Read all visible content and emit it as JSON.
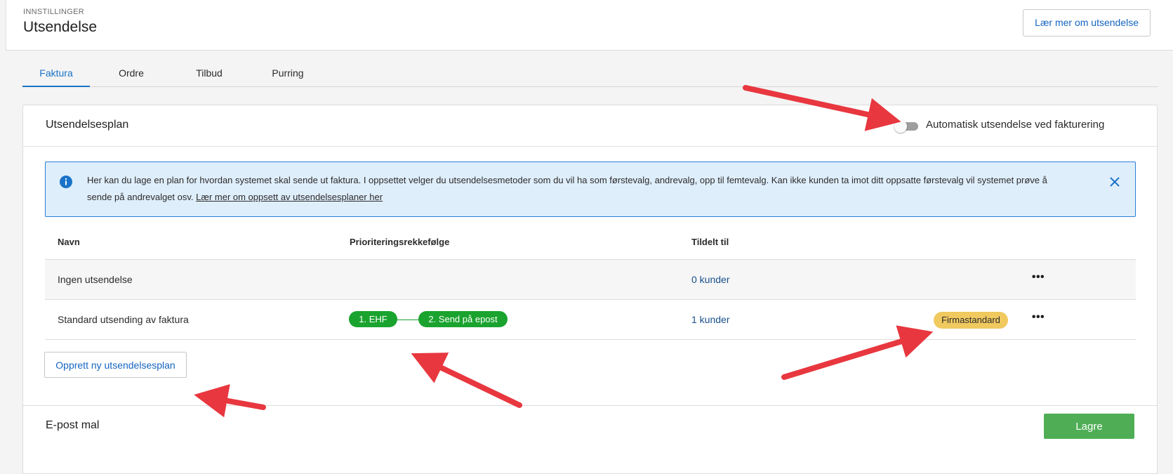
{
  "header": {
    "eyebrow": "INNSTILLINGER",
    "title": "Utsendelse",
    "learn_button": "Lær mer om utsendelse"
  },
  "tabs": [
    {
      "label": "Faktura",
      "active": true
    },
    {
      "label": "Ordre",
      "active": false
    },
    {
      "label": "Tilbud",
      "active": false
    },
    {
      "label": "Purring",
      "active": false
    }
  ],
  "plan_card": {
    "title": "Utsendelsesplan",
    "auto_toggle": {
      "label": "Automatisk utsendelse ved fakturering",
      "on": false
    },
    "info": {
      "text": "Her kan du lage en plan for hvordan systemet skal sende ut faktura. I oppsettet velger du utsendelsesmetoder som du vil ha som førstevalg, andrevalg, opp til femtevalg. Kan ikke kunden ta imot ditt oppsatte førstevalg vil systemet prøve å sende på andrevalget osv.",
      "link": "Lær mer om oppsett av utsendelsesplaner her"
    },
    "table": {
      "columns": [
        "Navn",
        "Prioriteringsrekkefølge",
        "Tildelt til"
      ],
      "rows": [
        {
          "name": "Ingen utsendelse",
          "priorities": [],
          "assigned": "0 kunder",
          "badge": ""
        },
        {
          "name": "Standard utsending av faktura",
          "priorities": [
            "1. EHF",
            "2. Send på epost"
          ],
          "assigned": "1 kunder",
          "badge": "Firmastandard"
        }
      ]
    },
    "create_button": "Opprett ny utsendelsesplan"
  },
  "email_card": {
    "title": "E-post mal",
    "save_button": "Lagre"
  },
  "colors": {
    "accent_blue": "#1a73c8",
    "pill_green": "#1aa32e",
    "badge_yellow": "#f0c95f",
    "save_green": "#4fae55",
    "annotation_red": "#e8373f"
  }
}
